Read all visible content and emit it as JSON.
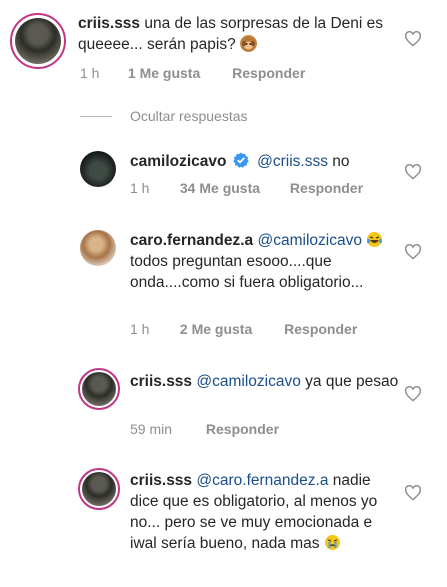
{
  "comments": [
    {
      "username": "criis.sss",
      "text": "una de las sorpresas de la Deni es queeee... serán papis?",
      "emoji": "monkey-emoji",
      "time": "1 h",
      "likes": "1 Me gusta",
      "reply_label": "Responder"
    }
  ],
  "hide_replies_label": "Ocultar respuestas",
  "replies": [
    {
      "username": "camilozicavo",
      "verified": true,
      "mention": "@criis.sss",
      "text": "no",
      "time": "1 h",
      "likes": "34 Me gusta",
      "reply_label": "Responder"
    },
    {
      "username": "caro.fernandez.a",
      "mention": "@camilozicavo",
      "emoji": "laughing-tears-emoji",
      "text": "todos preguntan esooo....que onda....como si fuera obligatorio...",
      "time": "1 h",
      "likes": "2 Me gusta",
      "reply_label": "Responder"
    },
    {
      "username": "criis.sss",
      "mention": "@camilozicavo",
      "text": "ya que pesao",
      "time": "59 min",
      "reply_label": "Responder"
    },
    {
      "username": "criis.sss",
      "mention": "@caro.fernandez.a",
      "text": "nadie dice que es obligatorio, al menos yo no... pero se ve muy emocionada e iwal sería bueno, nada mas",
      "emoji": "crying-face-emoji",
      "time": "",
      "reply_label": ""
    }
  ],
  "colors": {
    "text": "#262626",
    "meta": "#8e8e8e",
    "mention": "#1a4e8a",
    "verified": "#3897f0",
    "story_ring": "#c13584"
  }
}
